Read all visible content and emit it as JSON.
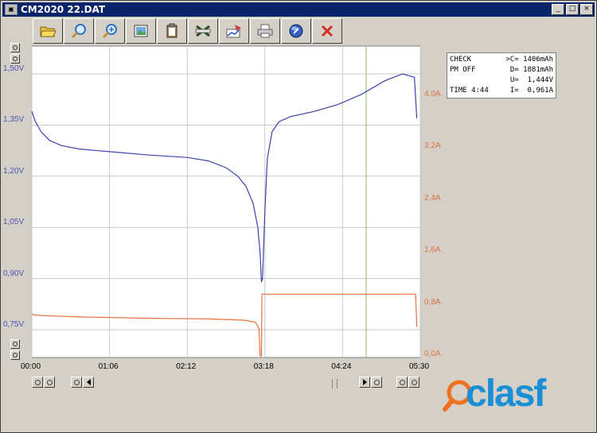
{
  "window": {
    "title": "CM2020  22.DAT",
    "app_icon": "window-app-icon",
    "controls": [
      "_",
      "□",
      "×"
    ]
  },
  "toolbar": {
    "buttons": [
      {
        "name": "open-folder-button",
        "icon": "folder-open-icon"
      },
      {
        "name": "zoom-button",
        "icon": "magnifier-icon"
      },
      {
        "name": "zoom-in-button",
        "icon": "magnifier-plus-icon"
      },
      {
        "name": "picture-button",
        "icon": "picture-icon"
      },
      {
        "name": "clipboard-button",
        "icon": "clipboard-icon"
      },
      {
        "name": "excel-button",
        "icon": "excel-icon"
      },
      {
        "name": "chart-button",
        "icon": "chart-icon"
      },
      {
        "name": "print-button",
        "icon": "printer-icon"
      },
      {
        "name": "info-button",
        "icon": "info-icon"
      },
      {
        "name": "close-button",
        "icon": "close-x-icon"
      }
    ]
  },
  "info_panel": {
    "rows": [
      {
        "left": "CHECK",
        "right": ">C= 1406mAh"
      },
      {
        "left": "PM OFF",
        "right": "D= 1881mAh"
      },
      {
        "left": "",
        "right": "U=  1,444V"
      },
      {
        "left": "TIME 4:44",
        "right": "I=  0,961A"
      }
    ]
  },
  "colors": {
    "voltage": "#3a45a8",
    "current": "#e07040",
    "grid": "#c8c8c8",
    "marker": "#8ab070"
  },
  "chart_data": {
    "type": "line",
    "x_ticks": [
      "00:00",
      "01:06",
      "02:12",
      "03:18",
      "04:24",
      "05:30"
    ],
    "y_left_ticks": [
      "0,75V",
      "0,90V",
      "1,05V",
      "1,20V",
      "1,35V",
      "1,50V"
    ],
    "y_right_ticks": [
      "0,0A",
      "0,8A",
      "1,6A",
      "2,4A",
      "3,2A",
      "4,0A"
    ],
    "y_left_range": [
      0.75,
      1.5
    ],
    "y_right_range": [
      0.0,
      4.0
    ],
    "x_range_min": [
      0,
      330
    ],
    "marker_x_min": 284,
    "series": [
      {
        "unit": "V",
        "points": [
          [
            0,
            1.39
          ],
          [
            3,
            1.36
          ],
          [
            8,
            1.33
          ],
          [
            15,
            1.305
          ],
          [
            25,
            1.29
          ],
          [
            40,
            1.28
          ],
          [
            66,
            1.272
          ],
          [
            100,
            1.262
          ],
          [
            132,
            1.255
          ],
          [
            150,
            1.245
          ],
          [
            165,
            1.225
          ],
          [
            175,
            1.2
          ],
          [
            182,
            1.17
          ],
          [
            188,
            1.12
          ],
          [
            192,
            1.05
          ],
          [
            194,
            0.97
          ],
          [
            195,
            0.89
          ],
          [
            196,
            0.9
          ],
          [
            198,
            1.1
          ],
          [
            200,
            1.25
          ],
          [
            204,
            1.33
          ],
          [
            210,
            1.36
          ],
          [
            220,
            1.375
          ],
          [
            240,
            1.39
          ],
          [
            260,
            1.41
          ],
          [
            280,
            1.44
          ],
          [
            300,
            1.48
          ],
          [
            315,
            1.5
          ],
          [
            325,
            1.49
          ],
          [
            327,
            1.37
          ]
        ]
      },
      {
        "unit": "A",
        "points": [
          [
            0,
            0.65
          ],
          [
            2,
            0.63
          ],
          [
            10,
            0.62
          ],
          [
            40,
            0.6
          ],
          [
            100,
            0.58
          ],
          [
            150,
            0.57
          ],
          [
            180,
            0.55
          ],
          [
            190,
            0.52
          ],
          [
            193,
            0.42
          ],
          [
            194,
            0.0
          ],
          [
            195,
            0.0
          ],
          [
            195.5,
            0.95
          ],
          [
            326,
            0.95
          ],
          [
            327,
            0.45
          ]
        ]
      }
    ]
  }
}
